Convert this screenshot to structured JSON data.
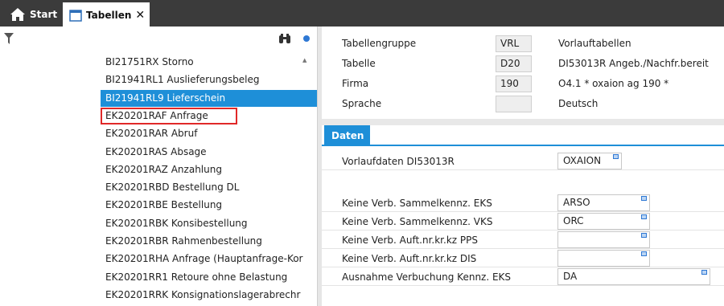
{
  "tabs": {
    "start": "Start",
    "tabellen": "Tabellen",
    "close": "✕"
  },
  "tree": {
    "items": [
      {
        "label": "BI21751RX  Storno"
      },
      {
        "label": "BI21941RL1  Auslieferungsbeleg"
      },
      {
        "label": "BI21941RL9  Lieferschein",
        "selected": true
      },
      {
        "label": "EK20201RAF  Anfrage",
        "highlighted": true
      },
      {
        "label": "EK20201RAR  Abruf"
      },
      {
        "label": "EK20201RAS  Absage"
      },
      {
        "label": "EK20201RAZ  Anzahlung"
      },
      {
        "label": "EK20201RBD  Bestellung  DL"
      },
      {
        "label": "EK20201RBE  Bestellung"
      },
      {
        "label": "EK20201RBK  Konsibestellung"
      },
      {
        "label": "EK20201RBR  Rahmenbestellung"
      },
      {
        "label": "EK20201RHA  Anfrage (Hauptanfrage-Kor"
      },
      {
        "label": "EK20201RR1  Retoure  ohne Belastung"
      },
      {
        "label": "EK20201RRK  Konsignationslagerabrechr"
      }
    ]
  },
  "header": {
    "rows": [
      {
        "label": "Tabellengruppe",
        "value": "VRL",
        "desc": "Vorlauftabellen"
      },
      {
        "label": "Tabelle",
        "value": "D20",
        "desc": "DI53013R Angeb./Nachfr.bereit"
      },
      {
        "label": "Firma",
        "value": "190",
        "desc": "O4.1 * oxaion ag 190   *"
      },
      {
        "label": "Sprache",
        "value": "",
        "desc": "Deutsch"
      }
    ]
  },
  "detail": {
    "tab_label": "Daten",
    "vorlauf_label": "Vorlaufdaten DI53013R",
    "vorlauf_value": "OXAION",
    "fields": [
      {
        "label": "Keine Verb. Sammelkennz. EKS",
        "value": "ARSO"
      },
      {
        "label": "Keine Verb. Sammelkennz. VKS",
        "value": "ORC"
      },
      {
        "label": "Keine Verb. Auft.nr.kr.kz PPS",
        "value": ""
      },
      {
        "label": "Keine Verb. Auft.nr.kr.kz DIS",
        "value": ""
      },
      {
        "label": "Ausnahme Verbuchung Kennz. EKS",
        "value": "DA"
      }
    ]
  },
  "colors": {
    "tabbar": "#3b3b3b",
    "accent": "#1e8fd8",
    "highlight_border": "#e02828"
  }
}
